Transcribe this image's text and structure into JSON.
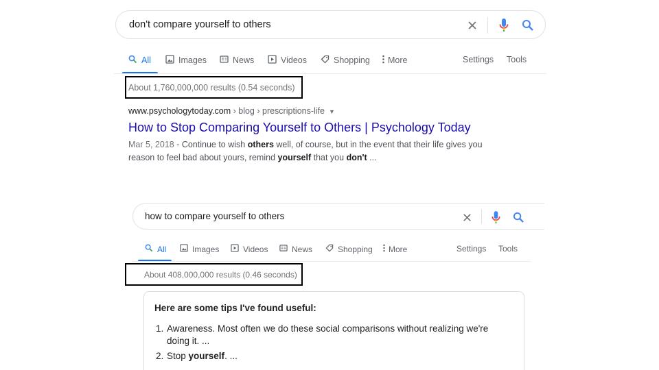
{
  "screenshot1": {
    "query": "don't compare yourself to others",
    "tabs": [
      {
        "label": "All",
        "icon": "search-icon"
      },
      {
        "label": "Images",
        "icon": "image-icon"
      },
      {
        "label": "News",
        "icon": "news-icon"
      },
      {
        "label": "Videos",
        "icon": "video-icon"
      },
      {
        "label": "Shopping",
        "icon": "tag-icon"
      },
      {
        "label": "More",
        "icon": "more-vert-icon"
      }
    ],
    "settings_label": "Settings",
    "tools_label": "Tools",
    "result_stats": "About 1,760,000,000 results (0.54 seconds)",
    "result": {
      "domain": "www.psychologytoday.com",
      "path": " › blog › prescriptions-life",
      "title": "How to Stop Comparing Yourself to Others | Psychology Today",
      "date": "Mar 5, 2018",
      "snippet_parts": [
        {
          "t": " - Continue to wish ",
          "b": false
        },
        {
          "t": "others",
          "b": true
        },
        {
          "t": " well, of course, but in the event that their life gives you reason to feel bad about yours, remind ",
          "b": false
        },
        {
          "t": "yourself",
          "b": true
        },
        {
          "t": " that you ",
          "b": false
        },
        {
          "t": "don't",
          "b": true
        },
        {
          "t": " ...",
          "b": false
        }
      ]
    }
  },
  "screenshot2": {
    "query": "how to compare yourself to others",
    "tabs": [
      {
        "label": "All",
        "icon": "search-icon"
      },
      {
        "label": "Images",
        "icon": "image-icon"
      },
      {
        "label": "Videos",
        "icon": "video-icon"
      },
      {
        "label": "News",
        "icon": "news-icon"
      },
      {
        "label": "Shopping",
        "icon": "tag-icon"
      },
      {
        "label": "More",
        "icon": "more-vert-icon"
      }
    ],
    "settings_label": "Settings",
    "tools_label": "Tools",
    "result_stats": "About 408,000,000 results (0.46 seconds)",
    "featured_snippet": {
      "heading": "Here are some tips I've found useful:",
      "items": [
        {
          "num": "1.",
          "parts": [
            {
              "t": "Awareness. Most often we do these social comparisons without realizing we're doing it. ...",
              "b": false
            }
          ]
        },
        {
          "num": "2.",
          "parts": [
            {
              "t": "Stop ",
              "b": false
            },
            {
              "t": "yourself",
              "b": true
            },
            {
              "t": ". ...",
              "b": false
            }
          ]
        }
      ]
    }
  },
  "colors": {
    "accent_blue": "#1a73e8",
    "link_title": "#1a0dab",
    "mic_red": "#ea4335",
    "highlight_box": "#000000"
  }
}
